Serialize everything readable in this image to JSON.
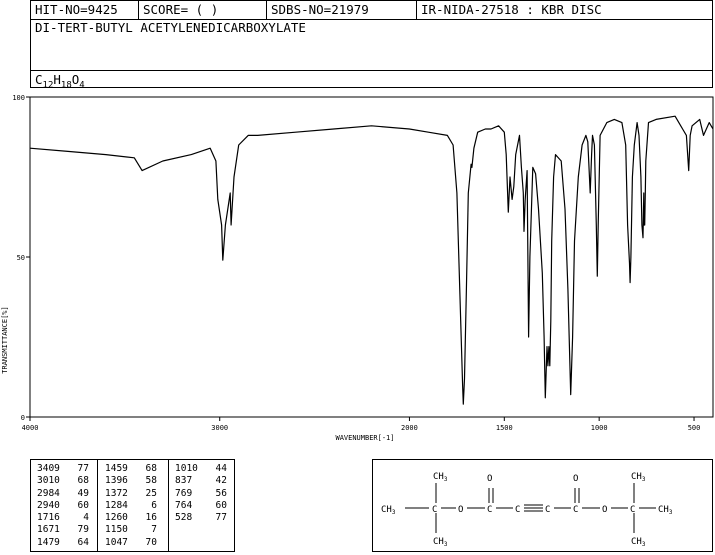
{
  "header": {
    "hit_no": "HIT-NO=9425",
    "score": "SCORE=  (   )",
    "sdbs_no": "SDBS-NO=21979",
    "ir_info": "IR-NIDA-27518 : KBR DISC",
    "compound_name": "DI-TERT-BUTYL ACETYLENEDICARBOXYLATE",
    "formula_parts": [
      "C",
      "12",
      "H",
      "18",
      "O",
      "4"
    ]
  },
  "chart_data": {
    "type": "line",
    "xlabel": "WAVENUMBER[-1]",
    "ylabel": "TRANSMITTANCE[%]",
    "xlim": [
      4000,
      400
    ],
    "ylim": [
      0,
      100
    ],
    "x_ticks": [
      4000,
      3000,
      2000,
      1500,
      1000,
      500
    ],
    "y_ticks": [
      0,
      50,
      100
    ],
    "x": [
      4000,
      3800,
      3600,
      3450,
      3409,
      3300,
      3150,
      3050,
      3020,
      3010,
      2990,
      2984,
      2970,
      2945,
      2940,
      2925,
      2900,
      2850,
      2800,
      2600,
      2400,
      2200,
      2000,
      1900,
      1800,
      1770,
      1750,
      1730,
      1720,
      1716,
      1710,
      1700,
      1690,
      1675,
      1671,
      1660,
      1640,
      1600,
      1570,
      1530,
      1500,
      1490,
      1479,
      1470,
      1459,
      1450,
      1440,
      1420,
      1410,
      1400,
      1396,
      1390,
      1380,
      1372,
      1365,
      1350,
      1335,
      1320,
      1300,
      1290,
      1284,
      1275,
      1270,
      1265,
      1260,
      1255,
      1250,
      1240,
      1230,
      1200,
      1180,
      1165,
      1150,
      1140,
      1130,
      1110,
      1090,
      1070,
      1060,
      1047,
      1040,
      1035,
      1025,
      1015,
      1010,
      1005,
      995,
      960,
      920,
      880,
      860,
      850,
      840,
      837,
      833,
      825,
      815,
      800,
      790,
      780,
      775,
      769,
      765,
      764,
      760,
      757,
      754,
      740,
      700,
      600,
      560,
      540,
      528,
      520,
      510,
      470,
      450,
      420,
      400
    ],
    "y": [
      84,
      83,
      82,
      81,
      77,
      80,
      82,
      84,
      80,
      68,
      60,
      49,
      60,
      70,
      60,
      75,
      85,
      88,
      88,
      89,
      90,
      91,
      90,
      89,
      88,
      85,
      70,
      30,
      10,
      4,
      12,
      40,
      70,
      79,
      78,
      84,
      89,
      90,
      90,
      91,
      89,
      82,
      64,
      75,
      68,
      72,
      82,
      88,
      78,
      70,
      58,
      68,
      77,
      25,
      50,
      78,
      76,
      65,
      45,
      25,
      6,
      22,
      16,
      22,
      16,
      30,
      55,
      75,
      82,
      80,
      65,
      40,
      7,
      25,
      55,
      75,
      85,
      88,
      86,
      70,
      82,
      88,
      85,
      60,
      44,
      60,
      88,
      92,
      93,
      92,
      85,
      60,
      48,
      42,
      50,
      75,
      85,
      92,
      88,
      75,
      60,
      56,
      70,
      60,
      60,
      70,
      80,
      92,
      93,
      94,
      90,
      88,
      77,
      88,
      91,
      93,
      88,
      92,
      90
    ]
  },
  "peak_table": {
    "columns": [
      [
        [
          "3409",
          "77"
        ],
        [
          "3010",
          "68"
        ],
        [
          "2984",
          "49"
        ],
        [
          "2940",
          "60"
        ],
        [
          "1716",
          "4"
        ],
        [
          "1671",
          "79"
        ],
        [
          "1479",
          "64"
        ]
      ],
      [
        [
          "1459",
          "68"
        ],
        [
          "1396",
          "58"
        ],
        [
          "1372",
          "25"
        ],
        [
          "1284",
          "6"
        ],
        [
          "1260",
          "16"
        ],
        [
          "1150",
          "7"
        ],
        [
          "1047",
          "70"
        ]
      ],
      [
        [
          "1010",
          "44"
        ],
        [
          "837",
          "42"
        ],
        [
          "769",
          "56"
        ],
        [
          "764",
          "60"
        ],
        [
          "528",
          "77"
        ]
      ]
    ]
  },
  "structure": {
    "ch3": "CH",
    "ch3_sub": "3",
    "c": "C",
    "o": "O"
  }
}
